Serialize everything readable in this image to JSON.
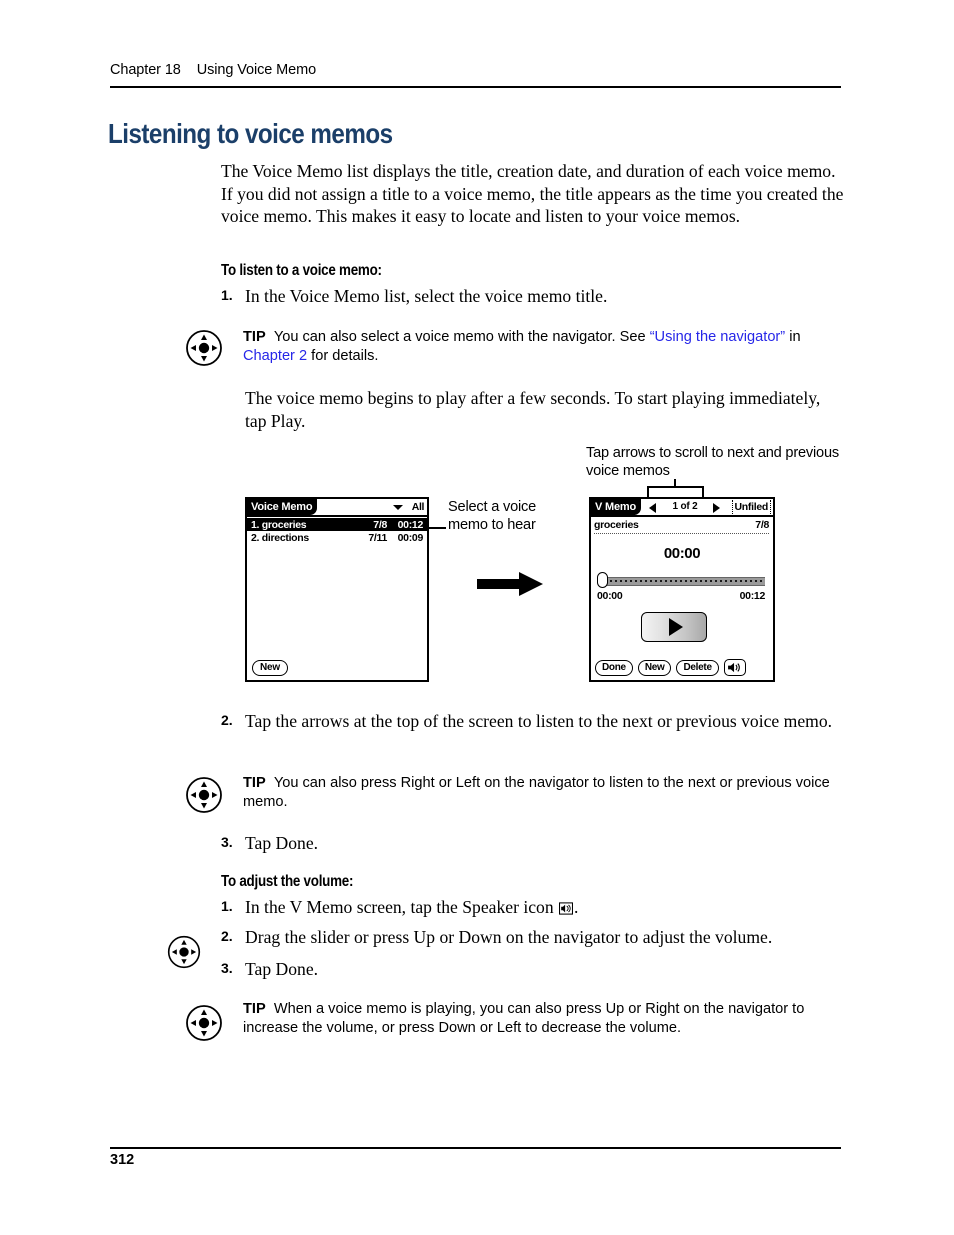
{
  "running_head": {
    "chapter": "Chapter 18",
    "title": "Using Voice Memo"
  },
  "page_title": "Listening to voice memos",
  "intro_paragraph": "The Voice Memo list displays the title, creation date, and duration of each voice memo. If you did not assign a title to a voice memo, the title appears as the time you created the voice memo. This makes it easy to locate and listen to your voice memos.",
  "section_listen": {
    "subhead": "To listen to a voice memo:",
    "step1": {
      "num": "1.",
      "text": "In the Voice Memo list, select the voice memo title."
    },
    "tip1": {
      "label": "TIP",
      "text_before": "You can also select a voice memo with the navigator. See ",
      "link1": "“Using the navigator”",
      "text_mid": " in ",
      "link2": "Chapter 2",
      "text_after": " for details."
    },
    "paragraph_after_tip": "The voice memo begins to play after a few seconds. To start playing immediately, tap Play.",
    "step2": {
      "num": "2.",
      "text": "Tap the arrows at the top of the screen to listen to the next or previous voice memo."
    },
    "tip2": {
      "label": "TIP",
      "text": "You can also press Right or Left on the navigator to listen to the next or previous voice memo."
    },
    "step3": {
      "num": "3.",
      "text": "Tap Done."
    }
  },
  "section_volume": {
    "subhead": "To adjust the volume:",
    "step1": {
      "num": "1.",
      "text_before": "In the V Memo screen, tap the Speaker icon ",
      "text_after": "."
    },
    "step2": {
      "num": "2.",
      "text": "Drag the slider or press Up or Down on the navigator to adjust the volume."
    },
    "step3": {
      "num": "3.",
      "text": "Tap Done."
    },
    "tip3": {
      "label": "TIP",
      "text": "When a voice memo is playing, you can also press Up or Right on the navigator to increase the volume, or press Down or Left to decrease the volume."
    }
  },
  "figure": {
    "callout_select": "Select a voice memo to hear",
    "callout_tap_arrows": "Tap arrows to scroll to next and previous voice memos",
    "voice_memo_list_screen": {
      "title": "Voice Memo",
      "category": "All",
      "columns": [
        "title",
        "date",
        "duration"
      ],
      "rows": [
        {
          "title": "1. groceries",
          "date": "7/8",
          "duration": "00:12",
          "selected": true
        },
        {
          "title": "2. directions",
          "date": "7/11",
          "duration": "00:09",
          "selected": false
        }
      ],
      "new_button": "New"
    },
    "v_memo_screen": {
      "title": "V Memo",
      "counter": "1 of 2",
      "category": "Unfiled",
      "memo_name": "groceries",
      "memo_date": "7/8",
      "elapsed_time": "00:00",
      "start_time": "00:00",
      "end_time": "00:12",
      "play_button": "play-triangle",
      "buttons": [
        "Done",
        "New",
        "Delete"
      ],
      "speaker_button": "speaker-icon"
    }
  },
  "footer": {
    "page_number": "312"
  },
  "colors": {
    "heading": "#1b3f69",
    "link": "#2626e8",
    "text": "#000000",
    "background": "#ffffff"
  }
}
